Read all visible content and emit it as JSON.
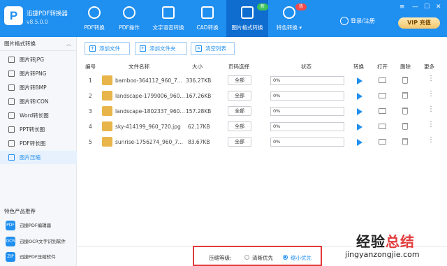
{
  "app": {
    "name": "迅捷PDF转换器",
    "version": "v8.5.0.0",
    "logo_letter": "P"
  },
  "nav": [
    {
      "label": "PDF转换",
      "icon": "convert-icon"
    },
    {
      "label": "PDF操作",
      "icon": "operate-icon"
    },
    {
      "label": "文字语音转换",
      "icon": "audio-wave-icon"
    },
    {
      "label": "CAD转换",
      "icon": "cad-icon"
    },
    {
      "label": "图片格式转换",
      "icon": "image-icon",
      "badge": "新",
      "active": true
    },
    {
      "label": "特色转换",
      "icon": "special-icon",
      "badge": "热",
      "dropdown": "▾"
    }
  ],
  "window": {
    "minimize": "—",
    "maximize": "☐",
    "close": "✕",
    "menu": "≡"
  },
  "user": {
    "login_label": "登录/注册"
  },
  "vip": {
    "label": "VIP 充值"
  },
  "sidebar": {
    "header": "图片格式转换",
    "items": [
      {
        "label": "图片转JPG"
      },
      {
        "label": "图片转PNG"
      },
      {
        "label": "图片转BMP"
      },
      {
        "label": "图片转ICON"
      },
      {
        "label": "Word转长图"
      },
      {
        "label": "PPT转长图"
      },
      {
        "label": "PDF转长图"
      },
      {
        "label": "图片压缩",
        "active": true
      }
    ],
    "featured_title": "特色产品推荐",
    "featured": [
      {
        "label": "迅捷PDF编辑器",
        "icon": "PDF"
      },
      {
        "label": "迅捷OCR文字识别软件",
        "icon": "OCR"
      },
      {
        "label": "迅捷PDF压缩软件",
        "icon": "ZIP"
      }
    ]
  },
  "toolbar": {
    "add_file": "添加文件",
    "add_folder": "添加文件夹",
    "clear_list": "清空列表"
  },
  "table": {
    "headers": [
      "编号",
      "文件名称",
      "大小",
      "页码选择",
      "状态",
      "转换",
      "打开",
      "删除",
      "更多"
    ],
    "rows": [
      {
        "no": "1",
        "name": "bamboo-364112_960_7...",
        "size": "336.27KB",
        "pages": "全部",
        "status": "0%"
      },
      {
        "no": "2",
        "name": "landscape-1799006_960...",
        "size": "167.26KB",
        "pages": "全部",
        "status": "0%"
      },
      {
        "no": "3",
        "name": "landscape-1802337_960...",
        "size": "157.28KB",
        "pages": "全部",
        "status": "0%"
      },
      {
        "no": "4",
        "name": "sky-414199_960_720.jpg",
        "size": "62.17KB",
        "pages": "全部",
        "status": "0%"
      },
      {
        "no": "5",
        "name": "sunrise-1756274_960_7...",
        "size": "83.67KB",
        "pages": "全部",
        "status": "0%"
      }
    ]
  },
  "compress": {
    "label": "压缩等级:",
    "option_clear": "清晰优先",
    "option_small": "缩小优先",
    "selected": "缩小优先"
  },
  "watermark": {
    "cn": "经验总结",
    "url": "jingyanzongjie.com"
  }
}
